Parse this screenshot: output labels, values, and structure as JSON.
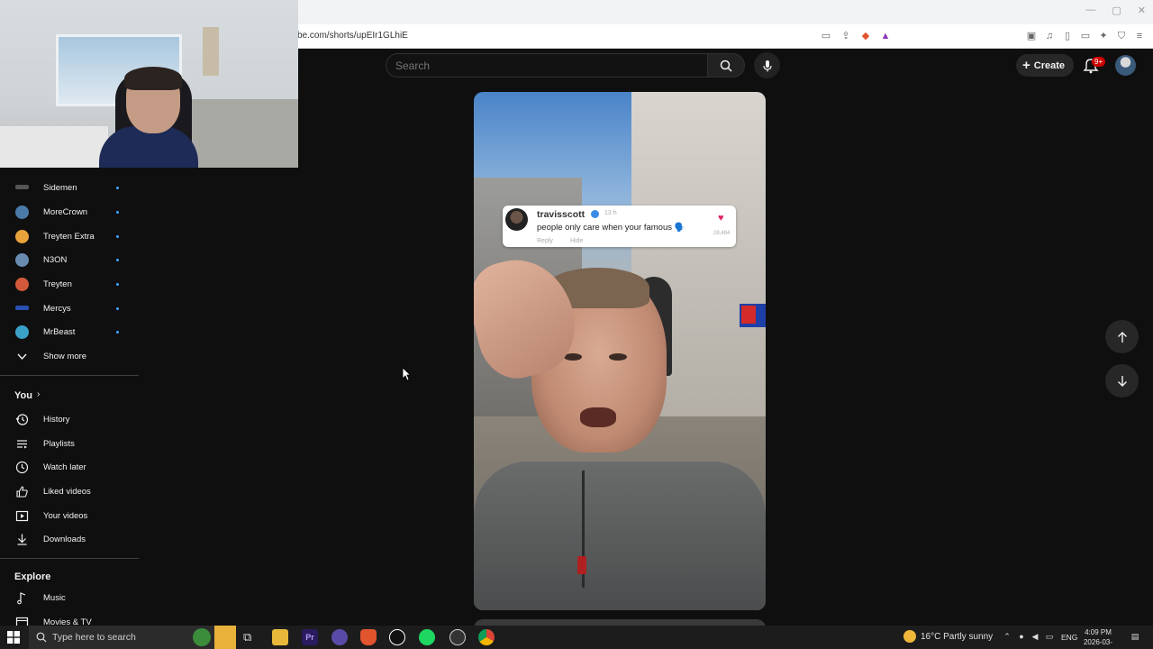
{
  "browser": {
    "url": "be.com/shorts/upEIr1GLhiE",
    "window_controls": [
      "—",
      "▢",
      "✕"
    ]
  },
  "header": {
    "search_placeholder": "Search",
    "create_label": "Create",
    "notifications_badge": "9+"
  },
  "sidebar": {
    "subscriptions": [
      {
        "label": "Sidemen",
        "color": "#555555"
      },
      {
        "label": "MoreCrown",
        "color": "#4a7aa8"
      },
      {
        "label": "Treyten Extra",
        "color": "#e8a33a"
      },
      {
        "label": "N3ON",
        "color": "#6a8bb0"
      },
      {
        "label": "Treyten",
        "color": "#d25a3a"
      },
      {
        "label": "Mercys",
        "color": "#2a4fb0"
      },
      {
        "label": "MrBeast",
        "color": "#3aa0c8"
      }
    ],
    "show_more": "Show more",
    "you_title": "You",
    "you_items": [
      {
        "label": "History",
        "icon": "history-icon"
      },
      {
        "label": "Playlists",
        "icon": "playlists-icon"
      },
      {
        "label": "Watch later",
        "icon": "clock-icon"
      },
      {
        "label": "Liked videos",
        "icon": "thumbs-up-icon"
      },
      {
        "label": "Your videos",
        "icon": "play-icon"
      },
      {
        "label": "Downloads",
        "icon": "download-icon"
      }
    ],
    "explore_title": "Explore",
    "explore_items": [
      {
        "label": "Music",
        "icon": "music-icon"
      },
      {
        "label": "Movies & TV",
        "icon": "film-icon"
      }
    ]
  },
  "short": {
    "comment": {
      "user": "travisscott",
      "time": "13 h",
      "text": "people only care when your famous 🗣️",
      "reply": "Reply",
      "hide": "Hide",
      "likes": "28,484"
    }
  },
  "taskbar": {
    "search_placeholder": "Type here to search",
    "weather": "16°C  Partly sunny",
    "language": "ENG",
    "time": "4:09 PM",
    "date": "2026-03-20"
  }
}
